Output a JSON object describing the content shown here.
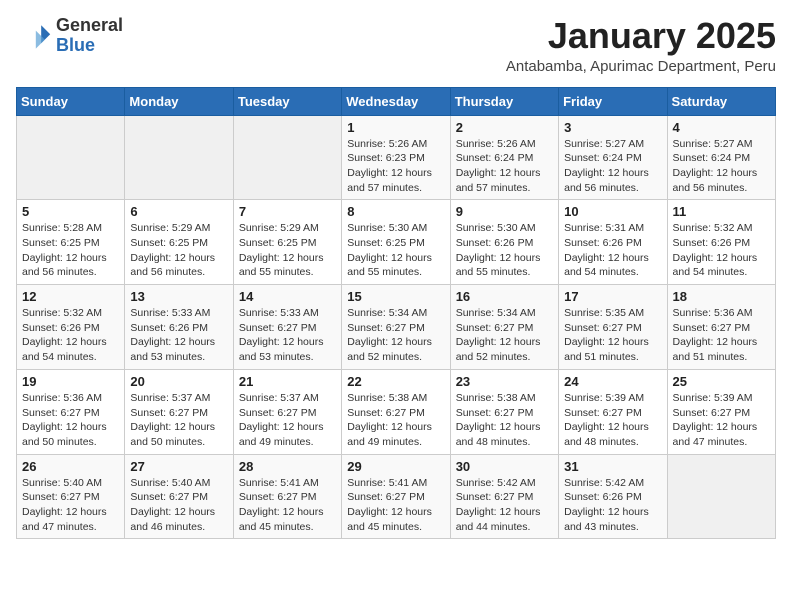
{
  "logo": {
    "general": "General",
    "blue": "Blue"
  },
  "header": {
    "title": "January 2025",
    "subtitle": "Antabamba, Apurimac Department, Peru"
  },
  "weekdays": [
    "Sunday",
    "Monday",
    "Tuesday",
    "Wednesday",
    "Thursday",
    "Friday",
    "Saturday"
  ],
  "weeks": [
    [
      {
        "day": null,
        "sunrise": null,
        "sunset": null,
        "daylight": null
      },
      {
        "day": null,
        "sunrise": null,
        "sunset": null,
        "daylight": null
      },
      {
        "day": null,
        "sunrise": null,
        "sunset": null,
        "daylight": null
      },
      {
        "day": "1",
        "sunrise": "5:26 AM",
        "sunset": "6:23 PM",
        "daylight": "12 hours and 57 minutes."
      },
      {
        "day": "2",
        "sunrise": "5:26 AM",
        "sunset": "6:24 PM",
        "daylight": "12 hours and 57 minutes."
      },
      {
        "day": "3",
        "sunrise": "5:27 AM",
        "sunset": "6:24 PM",
        "daylight": "12 hours and 56 minutes."
      },
      {
        "day": "4",
        "sunrise": "5:27 AM",
        "sunset": "6:24 PM",
        "daylight": "12 hours and 56 minutes."
      }
    ],
    [
      {
        "day": "5",
        "sunrise": "5:28 AM",
        "sunset": "6:25 PM",
        "daylight": "12 hours and 56 minutes."
      },
      {
        "day": "6",
        "sunrise": "5:29 AM",
        "sunset": "6:25 PM",
        "daylight": "12 hours and 56 minutes."
      },
      {
        "day": "7",
        "sunrise": "5:29 AM",
        "sunset": "6:25 PM",
        "daylight": "12 hours and 55 minutes."
      },
      {
        "day": "8",
        "sunrise": "5:30 AM",
        "sunset": "6:25 PM",
        "daylight": "12 hours and 55 minutes."
      },
      {
        "day": "9",
        "sunrise": "5:30 AM",
        "sunset": "6:26 PM",
        "daylight": "12 hours and 55 minutes."
      },
      {
        "day": "10",
        "sunrise": "5:31 AM",
        "sunset": "6:26 PM",
        "daylight": "12 hours and 54 minutes."
      },
      {
        "day": "11",
        "sunrise": "5:32 AM",
        "sunset": "6:26 PM",
        "daylight": "12 hours and 54 minutes."
      }
    ],
    [
      {
        "day": "12",
        "sunrise": "5:32 AM",
        "sunset": "6:26 PM",
        "daylight": "12 hours and 54 minutes."
      },
      {
        "day": "13",
        "sunrise": "5:33 AM",
        "sunset": "6:26 PM",
        "daylight": "12 hours and 53 minutes."
      },
      {
        "day": "14",
        "sunrise": "5:33 AM",
        "sunset": "6:27 PM",
        "daylight": "12 hours and 53 minutes."
      },
      {
        "day": "15",
        "sunrise": "5:34 AM",
        "sunset": "6:27 PM",
        "daylight": "12 hours and 52 minutes."
      },
      {
        "day": "16",
        "sunrise": "5:34 AM",
        "sunset": "6:27 PM",
        "daylight": "12 hours and 52 minutes."
      },
      {
        "day": "17",
        "sunrise": "5:35 AM",
        "sunset": "6:27 PM",
        "daylight": "12 hours and 51 minutes."
      },
      {
        "day": "18",
        "sunrise": "5:36 AM",
        "sunset": "6:27 PM",
        "daylight": "12 hours and 51 minutes."
      }
    ],
    [
      {
        "day": "19",
        "sunrise": "5:36 AM",
        "sunset": "6:27 PM",
        "daylight": "12 hours and 50 minutes."
      },
      {
        "day": "20",
        "sunrise": "5:37 AM",
        "sunset": "6:27 PM",
        "daylight": "12 hours and 50 minutes."
      },
      {
        "day": "21",
        "sunrise": "5:37 AM",
        "sunset": "6:27 PM",
        "daylight": "12 hours and 49 minutes."
      },
      {
        "day": "22",
        "sunrise": "5:38 AM",
        "sunset": "6:27 PM",
        "daylight": "12 hours and 49 minutes."
      },
      {
        "day": "23",
        "sunrise": "5:38 AM",
        "sunset": "6:27 PM",
        "daylight": "12 hours and 48 minutes."
      },
      {
        "day": "24",
        "sunrise": "5:39 AM",
        "sunset": "6:27 PM",
        "daylight": "12 hours and 48 minutes."
      },
      {
        "day": "25",
        "sunrise": "5:39 AM",
        "sunset": "6:27 PM",
        "daylight": "12 hours and 47 minutes."
      }
    ],
    [
      {
        "day": "26",
        "sunrise": "5:40 AM",
        "sunset": "6:27 PM",
        "daylight": "12 hours and 47 minutes."
      },
      {
        "day": "27",
        "sunrise": "5:40 AM",
        "sunset": "6:27 PM",
        "daylight": "12 hours and 46 minutes."
      },
      {
        "day": "28",
        "sunrise": "5:41 AM",
        "sunset": "6:27 PM",
        "daylight": "12 hours and 45 minutes."
      },
      {
        "day": "29",
        "sunrise": "5:41 AM",
        "sunset": "6:27 PM",
        "daylight": "12 hours and 45 minutes."
      },
      {
        "day": "30",
        "sunrise": "5:42 AM",
        "sunset": "6:27 PM",
        "daylight": "12 hours and 44 minutes."
      },
      {
        "day": "31",
        "sunrise": "5:42 AM",
        "sunset": "6:26 PM",
        "daylight": "12 hours and 43 minutes."
      },
      {
        "day": null,
        "sunrise": null,
        "sunset": null,
        "daylight": null
      }
    ]
  ]
}
